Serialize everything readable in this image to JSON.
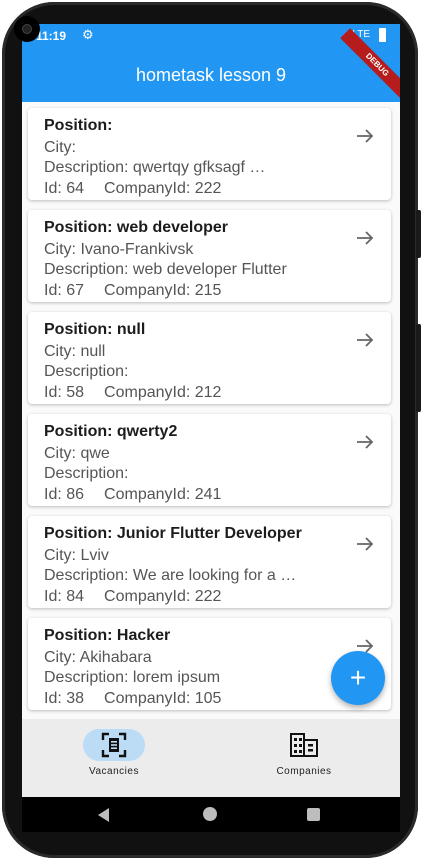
{
  "status": {
    "time": "11:19",
    "network": "LTE",
    "gear_icon": "gear-icon"
  },
  "appbar": {
    "title": "hometask lesson 9",
    "debug_banner": "DEBUG"
  },
  "vacancies": [
    {
      "position": "Position:",
      "city": "City:",
      "description": "Description: qwertqy gfksagf …",
      "id": "Id: 64",
      "company": "CompanyId: 222"
    },
    {
      "position": "Position: web developer",
      "city": "City: Ivano-Frankivsk",
      "description": "Description: web developer Flutter",
      "id": "Id: 67",
      "company": "CompanyId: 215"
    },
    {
      "position": "Position: null",
      "city": "City: null",
      "description": "Description:",
      "id": "Id: 58",
      "company": "CompanyId: 212"
    },
    {
      "position": "Position: qwerty2",
      "city": "City: qwe",
      "description": "Description:",
      "id": "Id: 86",
      "company": "CompanyId: 241"
    },
    {
      "position": "Position: Junior Flutter Developer",
      "city": "City: Lviv",
      "description": "Description: We are looking for a …",
      "id": "Id: 84",
      "company": "CompanyId: 222"
    },
    {
      "position": "Position: Hacker",
      "city": "City: Akihabara",
      "description": "Description: lorem ipsum",
      "id": "Id: 38",
      "company": "CompanyId: 105"
    }
  ],
  "fab": {
    "label": "+",
    "icon": "plus-icon"
  },
  "bottom_nav": {
    "items": [
      {
        "label": "Vacancies",
        "icon": "document-scan-icon",
        "active": true
      },
      {
        "label": "Companies",
        "icon": "building-icon",
        "active": false
      }
    ]
  },
  "colors": {
    "primary": "#2196f3",
    "nav_active": "#bcdcf6",
    "debug": "#b71c1c"
  }
}
